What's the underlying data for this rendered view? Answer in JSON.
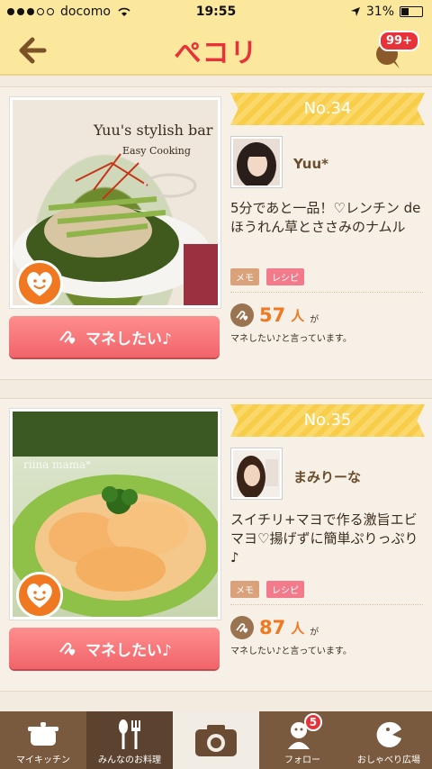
{
  "status_bar": {
    "carrier": "docomo",
    "time": "19:55",
    "battery": "31%"
  },
  "header": {
    "logo": "ぺコリ",
    "notification_count": "99+"
  },
  "posts": [
    {
      "rank": "No.34",
      "photo_title": "Yuu's stylish bar",
      "photo_subtitle": "Easy Cooking",
      "username": "Yuu*",
      "title": "5分であと一品！♡レンチン de ほうれん草とささみのナムル",
      "tag_memo": "メモ",
      "tag_recipe": "レシピ",
      "count": "57",
      "count_unit": "人",
      "count_particle": "が",
      "count_text": "マネしたい♪と言っています。",
      "button_label": "マネしたい♪"
    },
    {
      "rank": "No.35",
      "photo_watermark": "riina mama*",
      "username": "まみりーな",
      "title": "スイチリ+マヨで作る激旨エビマヨ♡揚げずに簡単ぷりっぷり♪",
      "tag_memo": "メモ",
      "tag_recipe": "レシピ",
      "count": "87",
      "count_unit": "人",
      "count_particle": "が",
      "count_text": "マネしたい♪と言っています。",
      "button_label": "マネしたい♪"
    }
  ],
  "tabbar": {
    "tabs": [
      {
        "label": "マイキッチン",
        "icon": "pot-icon"
      },
      {
        "label": "みんなのお料理",
        "icon": "fork-spoon-icon"
      },
      {
        "label": "",
        "icon": "camera-icon"
      },
      {
        "label": "フォロー",
        "icon": "follow-icon",
        "badge": "5"
      },
      {
        "label": "おしゃべり広場",
        "icon": "chat-character-icon"
      }
    ]
  },
  "colors": {
    "accent": "#f07820",
    "brand_red": "#e8323a",
    "header_yellow": "#fbe89c",
    "tabbar_brown": "#7a5a3e"
  }
}
